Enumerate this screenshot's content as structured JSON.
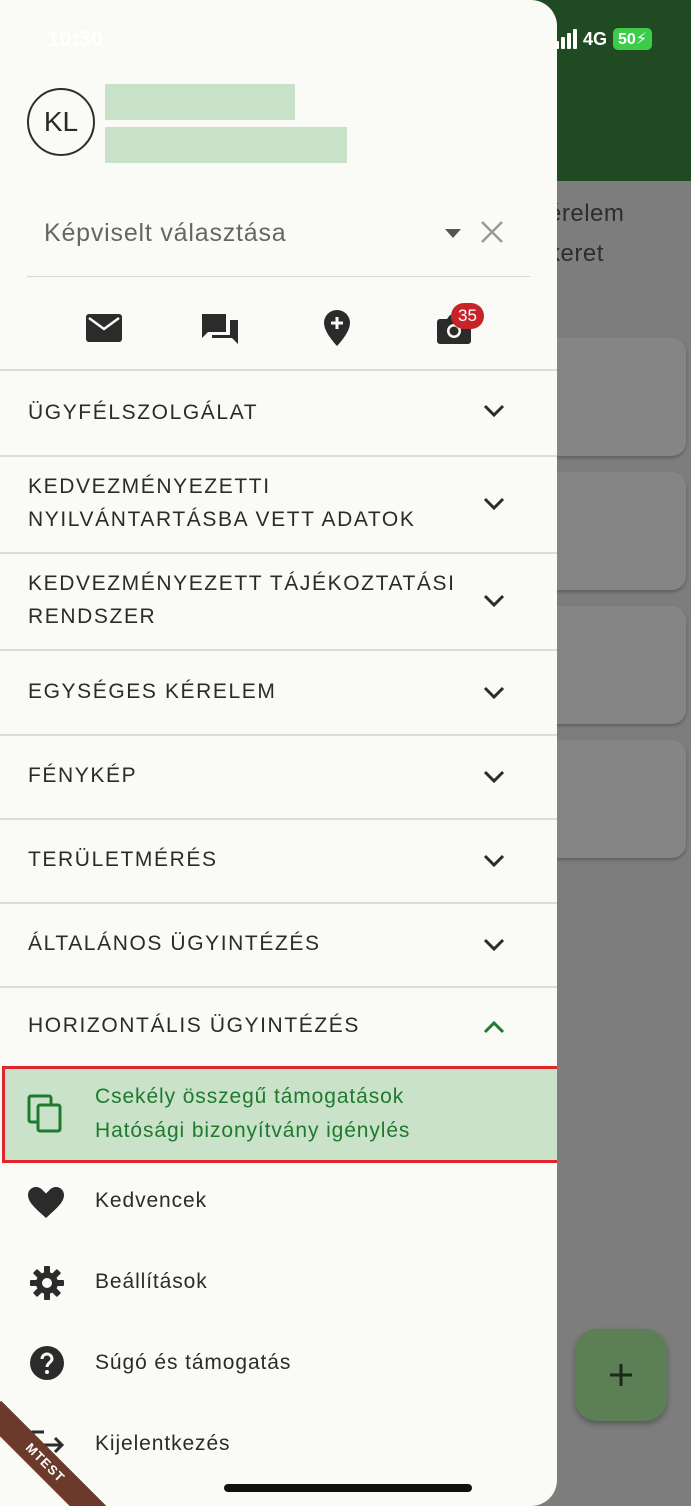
{
  "status_bar": {
    "time": "10:30",
    "network": "4G",
    "battery": "50"
  },
  "background": {
    "text_line1": "érelem",
    "text_line2": "keret",
    "fab_label": "+"
  },
  "drawer": {
    "avatar_initials": "KL",
    "select_placeholder": "Képviselt választása",
    "icons": [
      "mail-icon",
      "forum-icon",
      "add-location-icon",
      "camera-icon"
    ],
    "camera_badge": "35",
    "sections": [
      {
        "label": "ÜGYFÉLSZOLGÁLAT",
        "expanded": false
      },
      {
        "label": "KEDVEZMÉNYEZETTI NYILVÁNTARTÁSBA VETT ADATOK",
        "expanded": false
      },
      {
        "label": "KEDVEZMÉNYEZETT TÁJÉKOZTATÁSI RENDSZER",
        "expanded": false
      },
      {
        "label": "EGYSÉGES KÉRELEM",
        "expanded": false
      },
      {
        "label": "FÉNYKÉP",
        "expanded": false
      },
      {
        "label": "TERÜLETMÉRÉS",
        "expanded": false
      },
      {
        "label": "ÁLTALÁNOS ÜGYINTÉZÉS",
        "expanded": false
      },
      {
        "label": "HORIZONTÁLIS ÜGYINTÉZÉS",
        "expanded": true
      }
    ],
    "highlighted_item": {
      "line1": "Csekély összegű támogatások",
      "line2": "Hatósági bizonyítvány igénylés",
      "icon": "copy-icon"
    },
    "items": [
      {
        "label": "Kedvencek",
        "icon": "heart-icon"
      },
      {
        "label": "Beállítások",
        "icon": "gear-icon"
      },
      {
        "label": "Súgó és támogatás",
        "icon": "help-icon"
      },
      {
        "label": "Kijelentkezés",
        "icon": "logout-icon"
      }
    ]
  },
  "watermark": "MTEST",
  "colors": {
    "primary_green": "#1f4a22",
    "highlight_bg": "#c9e2c9",
    "highlight_border": "#e0252b",
    "badge": "#c7242a"
  }
}
